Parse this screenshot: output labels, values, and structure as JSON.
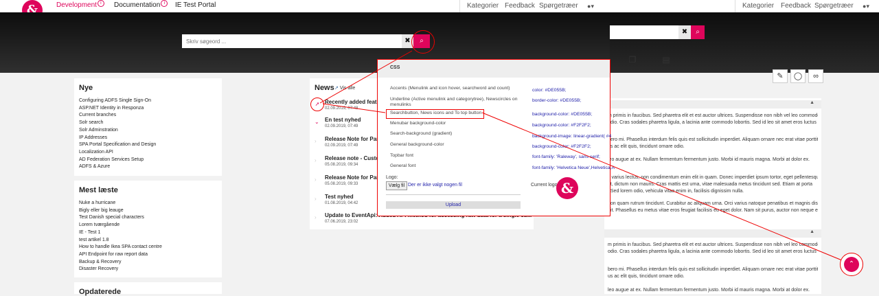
{
  "bg": {
    "nav": [
      "Kategorier",
      "Feedback",
      "Spørgetræer"
    ],
    "tools": [
      "copy-icon",
      "rss-icon"
    ],
    "tool_buttons": [
      "edit-icon",
      "bulb-icon",
      "link-icon"
    ],
    "collapse": "▲",
    "paras": [
      "m primis in faucibus. Sed pharetra elit et est auctor ultrices. Suspendisse non nibh vel leo commodo",
      "odio. Cras sodales pharetra ligula, a lacinia ante commodo lobortis. Sed id leo sit amet eros luctus",
      "bero mi. Phasellus interdum felis quis est sollicitudin imperdiet. Aliquam ornare nec erat vitae porttitor.",
      "us ac elit quis, tincidunt ornare odio.",
      "leo augue at ex. Nullam fermentum fermentum justo. Morbi id mauris magna. Morbi at dolor ex.",
      "s varius lectus, non condimentum enim elit in quam. Donec imperdiet ipsum tortor, eget pellentesque",
      "at, dictum non mauris. Cras mattis est urna, vitae malesuada metus tincidunt sed. Etiam at porta",
      ". Sed lorem odio, vehicula vitae enim in, facilisis dignissim nulla.",
      "non quam rutrum tincidunt. Curabitur ac aliquam urna. Orci varius natoque penatibus et magnis dis",
      "dit. Phasellus eu metus vitae eros feugiat facilisis eu eget dolor. Nam sit purus, auctor non neque et,",
      "m primis in faucibus. Sed pharetra elit et est auctor ultrices. Suspendisse non nibh vel leo commodo",
      "odio. Cras sodales pharetra ligula, a lacinia ante commodo lobortis. Sed id leo sit amet eros luctus",
      "bero mi. Phasellus interdum felis quis est sollicitudin imperdiet. Aliquam ornare nec erat vitae porttitor.",
      "us ac elit quis, tincidunt ornare odio.",
      "leo augue at ex. Nullam fermentum fermentum justo. Morbi id mauris magna. Morbi at dolor ex."
    ]
  },
  "logo": "&",
  "topnav": {
    "development": "Development",
    "documentation": "Documentation",
    "ie_test_portal": "IE Test Portal",
    "info_glyph": "i",
    "kategorier": "Kategorier",
    "feedback": "Feedback",
    "spoergetraeer": "Spørgetræer",
    "user_glyph": "▾"
  },
  "search": {
    "placeholder": "Skriv søgeord ...",
    "clear": "✖",
    "button": "⌕"
  },
  "nye": {
    "title": "Nye",
    "items": [
      "Configuring ADFS Single Sign-On",
      "ASP.NET Identity in Responza",
      "Current branches",
      "Solr search",
      "Solr Adminstration",
      "IP Addresses",
      "SPA Portal Specification and Design",
      "Localization API",
      "AD Federation Services Setup",
      "ADFS & Azure"
    ]
  },
  "mest": {
    "title": "Mest læste",
    "items": [
      "Nuke a hurricane",
      "Bigly eller big leauge",
      "Test Danish special characters",
      "Lorem tværgående",
      "IE - Test 1",
      "test artikel 1.8",
      "How to handle Ikea SPA contact centre",
      "API Endpoint for raw report data",
      "Backup & Recovery",
      "Disaster Recovery"
    ]
  },
  "opdaterede": {
    "title": "Opdaterede"
  },
  "news": {
    "title": "News",
    "link": "Vis alle",
    "items": [
      {
        "title": "Recently added featu",
        "date": "02.09.2019, 07:48"
      },
      {
        "title": "En test nyhed",
        "date": "02.09.2019, 07:49"
      },
      {
        "title": "Release Note for Part",
        "date": "02.09.2019, 07:49"
      },
      {
        "title": "Release note - Custo",
        "date": "05.08.2019, 09:34"
      },
      {
        "title": "Release Note for Part",
        "date": "05.08.2019, 09:33"
      },
      {
        "title": "Test nyhed",
        "date": "01.08.2019, 04:42"
      },
      {
        "title": "Update to EventApi: Added API method for accessing raw data for a single cu...",
        "date": "07.06.2019, 23:02"
      }
    ]
  },
  "css_popup": {
    "title": "CSS",
    "labels": [
      "Accents (Menulink and icon hover, searchword and count)",
      "Underline (Active menulink and categorytree), Newscircles on",
      "menulinks",
      "Searchbutton, News icons and To top button",
      "Menubar background-color",
      "Search-background (gradient)",
      "General background-color",
      "Topbar font",
      "General font"
    ],
    "values": [
      "color: #DE055B;",
      "border-color: #DE055B;",
      "background-color: #DE055B;",
      "background-color: #F2F2F2;",
      "background-image: linear-gradient( #4",
      "background-color: #F2F2F2;",
      "font-family: 'Raleway', sans-serif;",
      "font-family: 'Helvetica Neue',Helvetica,A"
    ],
    "logo_label": "Logo:",
    "choose": "Vælg fil",
    "nofile": "Der er ikke valgt nogen fil",
    "current_logo": "Current logo:",
    "upload": "Upload"
  },
  "icons": {
    "pin": "pin-icon",
    "chevron": "chevron-down-icon",
    "arrow_up": "arrow-up-icon",
    "external": "external-link-icon"
  },
  "colors": {
    "accent": "#DE055B",
    "background": "#F2F2F2",
    "annotation": "#EE0000"
  }
}
